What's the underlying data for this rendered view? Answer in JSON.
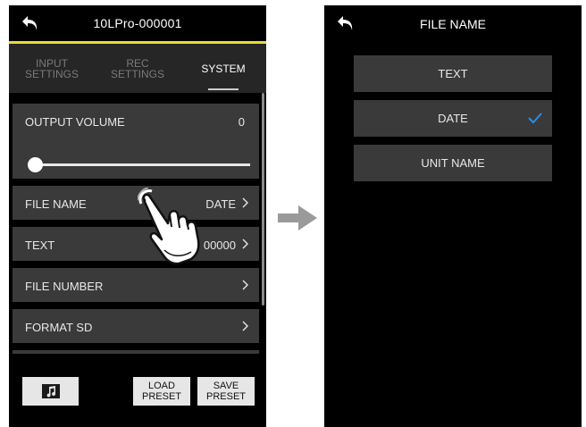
{
  "left_screen": {
    "header": {
      "title": "10LPro-000001"
    },
    "tabs": [
      {
        "label": "INPUT\nSETTINGS",
        "active": false
      },
      {
        "label": "REC\nSETTINGS",
        "active": false
      },
      {
        "label": "SYSTEM",
        "active": true
      }
    ],
    "rows": {
      "output_volume": {
        "label": "OUTPUT VOLUME",
        "value": "0",
        "slider_level": 0
      },
      "file_name": {
        "label": "FILE NAME",
        "value": "DATE"
      },
      "text": {
        "label": "TEXT",
        "value": "00000"
      },
      "file_number": {
        "label": "FILE NUMBER"
      },
      "format_sd": {
        "label": "FORMAT SD"
      }
    },
    "bottom": {
      "music_icon": "music-note-icon",
      "load_preset": "LOAD\nPRESET",
      "save_preset": "SAVE\nPRESET"
    }
  },
  "right_screen": {
    "header": {
      "title": "FILE NAME"
    },
    "options": [
      {
        "label": "TEXT",
        "selected": false
      },
      {
        "label": "DATE",
        "selected": true
      },
      {
        "label": "UNIT NAME",
        "selected": false
      }
    ]
  },
  "colors": {
    "accent_yellow": "#e5dc3a",
    "check_blue": "#2a8ce6",
    "row_bg": "#3a3a3a"
  }
}
